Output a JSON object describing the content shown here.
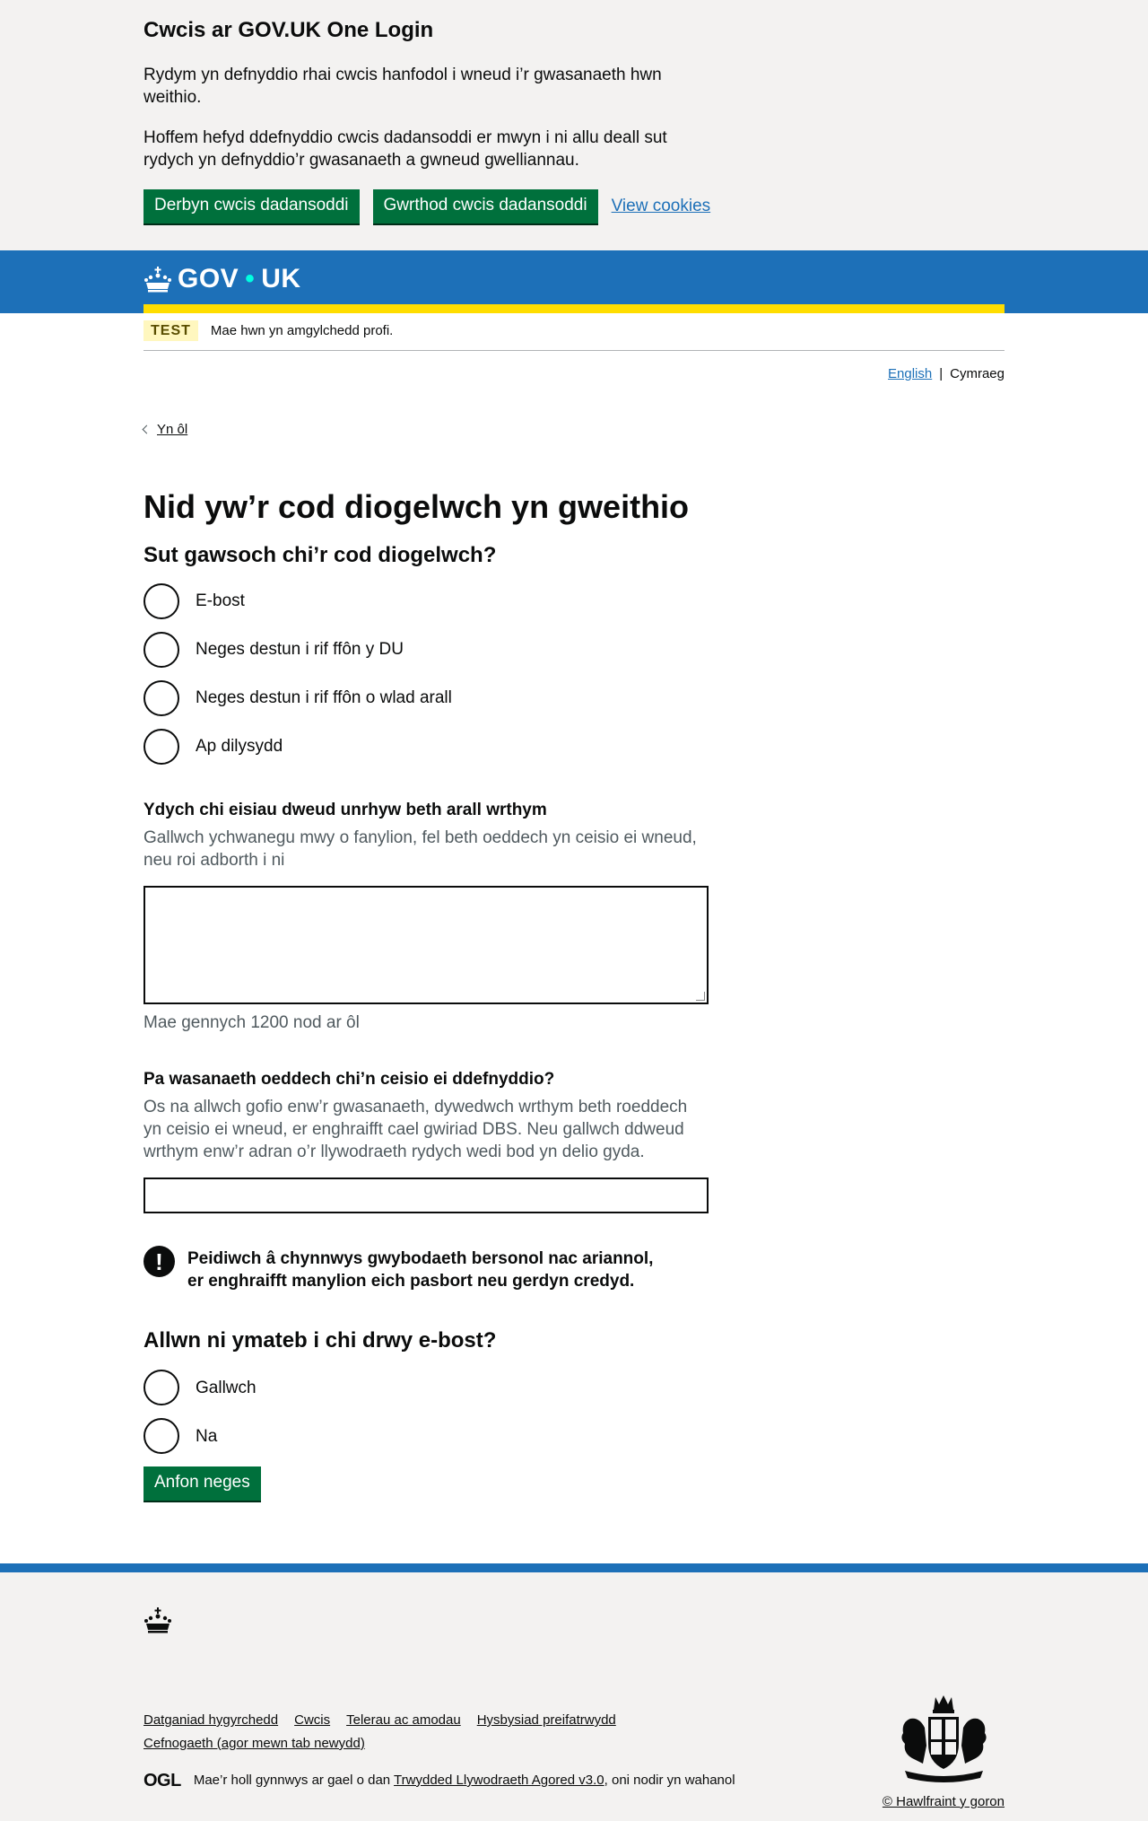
{
  "cookie_banner": {
    "title": "Cwcis ar GOV.UK One Login",
    "para1": "Rydym yn defnyddio rhai cwcis hanfodol i wneud i’r gwasanaeth hwn weithio.",
    "para2": "Hoffem hefyd ddefnyddio cwcis dadansoddi er mwyn i ni allu deall sut rydych yn defnyddio’r gwasanaeth a gwneud gwelliannau.",
    "accept_label": "Derbyn cwcis dadansoddi",
    "reject_label": "Gwrthod cwcis dadansoddi",
    "view_label": "View cookies"
  },
  "header": {
    "logo_left": "GOV",
    "logo_dot": "•",
    "logo_right": "UK"
  },
  "phase": {
    "tag": "TEST",
    "text": "Mae hwn yn amgylchedd profi."
  },
  "language": {
    "english": "English",
    "separator": "|",
    "welsh": "Cymraeg"
  },
  "back_link": "Yn ôl",
  "page_title": "Nid yw’r cod diogelwch yn gweithio",
  "question1": {
    "legend": "Sut gawsoch chi’r cod diogelwch?",
    "options": [
      "E-bost",
      "Neges destun i rif ffôn y DU",
      "Neges destun i rif ffôn o wlad arall",
      "Ap dilysydd"
    ]
  },
  "details": {
    "label": "Ydych chi eisiau dweud unrhyw beth arall wrthym",
    "hint": "Gallwch ychwanegu mwy o fanylion, fel beth oeddech yn ceisio ei wneud, neu roi adborth i ni",
    "counter": "Mae gennych 1200 nod ar ôl"
  },
  "service": {
    "label": "Pa wasanaeth oeddech chi’n ceisio ei ddefnyddio?",
    "hint": "Os na allwch gofio enw’r gwasanaeth, dywedwch wrthym beth roeddech yn ceisio ei wneud, er enghraifft cael gwiriad DBS. Neu gallwch ddweud wrthym enw’r adran o’r llywodraeth rydych wedi bod yn delio gyda."
  },
  "warning": {
    "icon": "!",
    "text": "Peidiwch â chynnwys gwybodaeth bersonol nac ariannol, er enghraifft manylion eich pasbort neu gerdyn credyd."
  },
  "question2": {
    "legend": "Allwn ni ymateb i chi drwy e-bost?",
    "options": [
      "Gallwch",
      "Na"
    ]
  },
  "submit_label": "Anfon neges",
  "footer": {
    "links": [
      "Datganiad hygyrchedd",
      "Cwcis",
      "Telerau ac amodau",
      "Hysbysiad preifatrwydd",
      "Cefnogaeth (agor mewn tab newydd)"
    ],
    "ogl": "OGL",
    "licence_prefix": "Mae’r holl gynnwys ar gael o dan",
    "licence_link": "Trwydded Llywodraeth Agored v3.0",
    "licence_suffix": ", oni nodir yn wahanol",
    "copyright": "© Hawlfraint y goron"
  },
  "colors": {
    "brand_blue": "#1d70b8",
    "button_green": "#00703c",
    "stripe_yellow": "#ffdd00"
  }
}
